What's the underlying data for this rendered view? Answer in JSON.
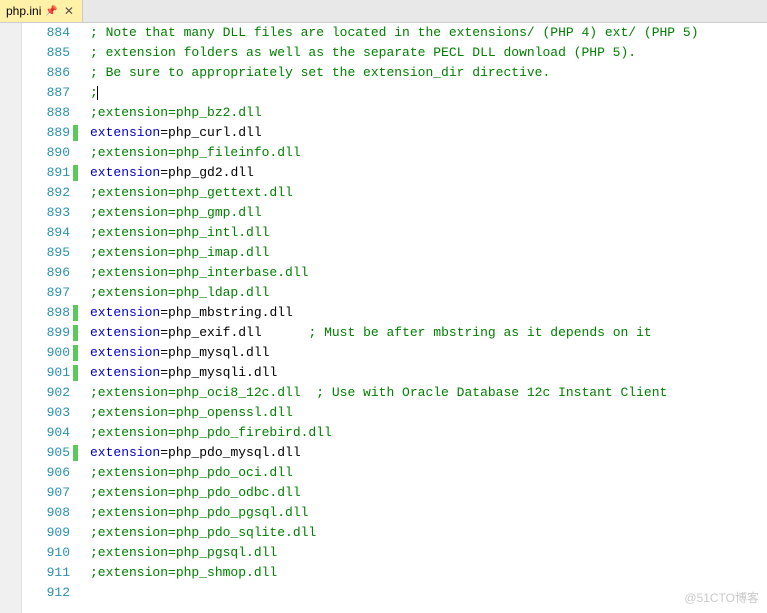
{
  "tab": {
    "title": "php.ini"
  },
  "watermark": "@51CTO博客",
  "lines": [
    {
      "n": 884,
      "mark": false,
      "tokens": [
        {
          "t": "; Note that many DLL files are located in the extensions/ (PHP 4) ext/ (PHP 5)",
          "c": "k-comment"
        }
      ]
    },
    {
      "n": 885,
      "mark": false,
      "tokens": [
        {
          "t": "; extension folders as well as the separate PECL DLL download (PHP 5).",
          "c": "k-comment"
        }
      ]
    },
    {
      "n": 886,
      "mark": false,
      "tokens": [
        {
          "t": "; Be sure to appropriately set the extension_dir directive.",
          "c": "k-comment"
        }
      ]
    },
    {
      "n": 887,
      "mark": false,
      "caret": true,
      "tokens": [
        {
          "t": ";",
          "c": "k-comment"
        }
      ]
    },
    {
      "n": 888,
      "mark": false,
      "tokens": [
        {
          "t": ";extension=php_bz2.dll",
          "c": "k-comment"
        }
      ]
    },
    {
      "n": 889,
      "mark": true,
      "tokens": [
        {
          "t": "extension",
          "c": "k-key"
        },
        {
          "t": "=",
          "c": "k-eq"
        },
        {
          "t": "php_curl.dll",
          "c": "k-val"
        }
      ]
    },
    {
      "n": 890,
      "mark": false,
      "tokens": [
        {
          "t": ";extension=php_fileinfo.dll",
          "c": "k-comment"
        }
      ]
    },
    {
      "n": 891,
      "mark": true,
      "tokens": [
        {
          "t": "extension",
          "c": "k-key"
        },
        {
          "t": "=",
          "c": "k-eq"
        },
        {
          "t": "php_gd2.dll",
          "c": "k-val"
        }
      ]
    },
    {
      "n": 892,
      "mark": false,
      "tokens": [
        {
          "t": ";extension=php_gettext.dll",
          "c": "k-comment"
        }
      ]
    },
    {
      "n": 893,
      "mark": false,
      "tokens": [
        {
          "t": ";extension=php_gmp.dll",
          "c": "k-comment"
        }
      ]
    },
    {
      "n": 894,
      "mark": false,
      "tokens": [
        {
          "t": ";extension=php_intl.dll",
          "c": "k-comment"
        }
      ]
    },
    {
      "n": 895,
      "mark": false,
      "tokens": [
        {
          "t": ";extension=php_imap.dll",
          "c": "k-comment"
        }
      ]
    },
    {
      "n": 896,
      "mark": false,
      "tokens": [
        {
          "t": ";extension=php_interbase.dll",
          "c": "k-comment"
        }
      ]
    },
    {
      "n": 897,
      "mark": false,
      "tokens": [
        {
          "t": ";extension=php_ldap.dll",
          "c": "k-comment"
        }
      ]
    },
    {
      "n": 898,
      "mark": true,
      "tokens": [
        {
          "t": "extension",
          "c": "k-key"
        },
        {
          "t": "=",
          "c": "k-eq"
        },
        {
          "t": "php_mbstring.dll",
          "c": "k-val"
        }
      ]
    },
    {
      "n": 899,
      "mark": true,
      "tokens": [
        {
          "t": "extension",
          "c": "k-key"
        },
        {
          "t": "=",
          "c": "k-eq"
        },
        {
          "t": "php_exif.dll      ",
          "c": "k-val"
        },
        {
          "t": "; Must be after mbstring as it depends on it",
          "c": "k-comment"
        }
      ]
    },
    {
      "n": 900,
      "mark": true,
      "tokens": [
        {
          "t": "extension",
          "c": "k-key"
        },
        {
          "t": "=",
          "c": "k-eq"
        },
        {
          "t": "php_mysql.dll",
          "c": "k-val"
        }
      ]
    },
    {
      "n": 901,
      "mark": true,
      "tokens": [
        {
          "t": "extension",
          "c": "k-key"
        },
        {
          "t": "=",
          "c": "k-eq"
        },
        {
          "t": "php_mysqli.dll",
          "c": "k-val"
        }
      ]
    },
    {
      "n": 902,
      "mark": false,
      "tokens": [
        {
          "t": ";extension=php_oci8_12c.dll  ; Use with Oracle Database 12c Instant Client",
          "c": "k-comment"
        }
      ]
    },
    {
      "n": 903,
      "mark": false,
      "tokens": [
        {
          "t": ";extension=php_openssl.dll",
          "c": "k-comment"
        }
      ]
    },
    {
      "n": 904,
      "mark": false,
      "tokens": [
        {
          "t": ";extension=php_pdo_firebird.dll",
          "c": "k-comment"
        }
      ]
    },
    {
      "n": 905,
      "mark": true,
      "tokens": [
        {
          "t": "extension",
          "c": "k-key"
        },
        {
          "t": "=",
          "c": "k-eq"
        },
        {
          "t": "php_pdo_mysql.dll",
          "c": "k-val"
        }
      ]
    },
    {
      "n": 906,
      "mark": false,
      "tokens": [
        {
          "t": ";extension=php_pdo_oci.dll",
          "c": "k-comment"
        }
      ]
    },
    {
      "n": 907,
      "mark": false,
      "tokens": [
        {
          "t": ";extension=php_pdo_odbc.dll",
          "c": "k-comment"
        }
      ]
    },
    {
      "n": 908,
      "mark": false,
      "tokens": [
        {
          "t": ";extension=php_pdo_pgsql.dll",
          "c": "k-comment"
        }
      ]
    },
    {
      "n": 909,
      "mark": false,
      "tokens": [
        {
          "t": ";extension=php_pdo_sqlite.dll",
          "c": "k-comment"
        }
      ]
    },
    {
      "n": 910,
      "mark": false,
      "tokens": [
        {
          "t": ";extension=php_pgsql.dll",
          "c": "k-comment"
        }
      ]
    },
    {
      "n": 911,
      "mark": false,
      "tokens": [
        {
          "t": ";extension=php_shmop.dll",
          "c": "k-comment"
        }
      ]
    },
    {
      "n": 912,
      "mark": false,
      "tokens": []
    }
  ]
}
